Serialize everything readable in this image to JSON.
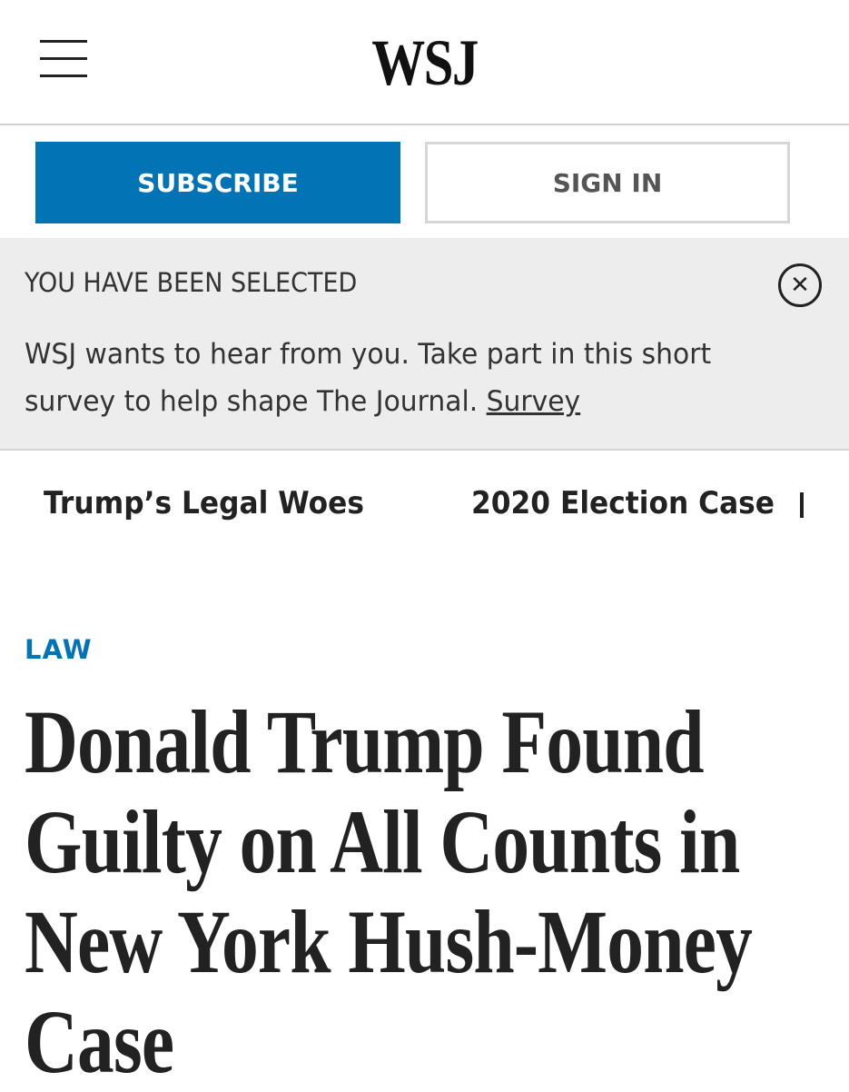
{
  "header": {
    "logo": "WSJ",
    "menu_icon": "hamburger-menu-icon"
  },
  "actions": {
    "subscribe_label": "SUBSCRIBE",
    "signin_label": "SIGN IN"
  },
  "survey": {
    "title": "YOU HAVE BEEN SELECTED",
    "text": "WSJ wants to hear from you. Take part in this short survey to help shape The Journal.",
    "link_label": "Survey",
    "close_icon": "close-icon"
  },
  "topics": [
    {
      "label": "Trump’s Legal Woes"
    },
    {
      "label": "2020 Election Case"
    }
  ],
  "article": {
    "section": "LAW",
    "headline": "Donald Trump Found Guilty on All Counts in New York Hush-Money Case"
  },
  "colors": {
    "accent": "#0274b6",
    "survey_bg": "#ededed",
    "text": "#222222"
  }
}
